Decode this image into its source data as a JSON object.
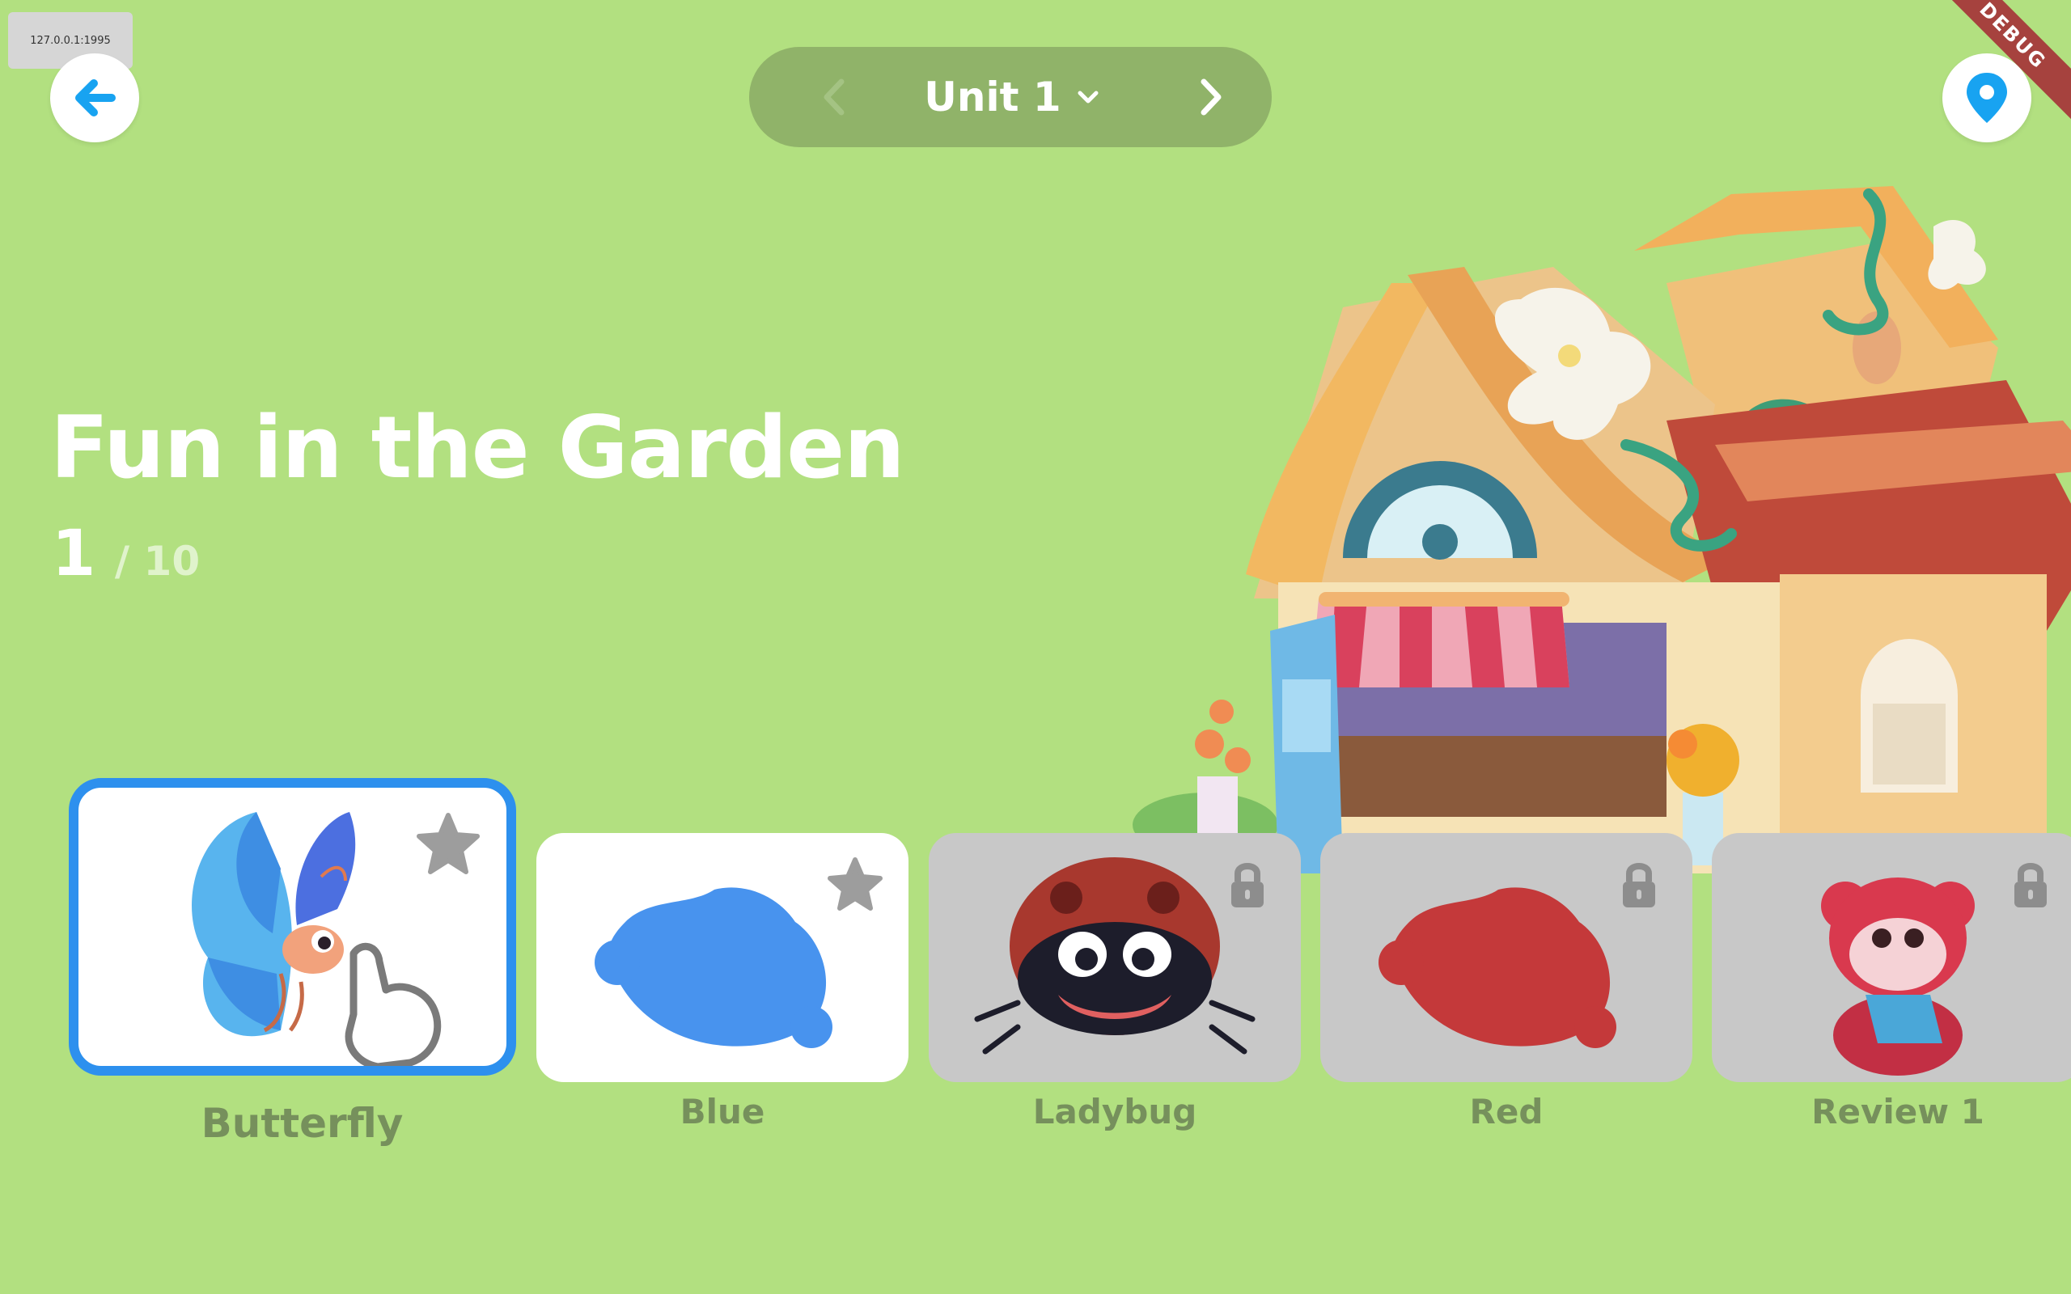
{
  "host_badge": "127.0.0.1:1995",
  "debug_banner": "DEBUG",
  "header": {
    "unit_label": "Unit 1"
  },
  "title": "Fun in the Garden",
  "progress": {
    "current": "1",
    "total": "/ 10"
  },
  "lessons": [
    {
      "label": "Butterfly",
      "state": "selected",
      "corner": "star-icon"
    },
    {
      "label": "Blue",
      "state": "available",
      "corner": "star-icon"
    },
    {
      "label": "Ladybug",
      "state": "locked",
      "corner": "lock-icon"
    },
    {
      "label": "Red",
      "state": "locked",
      "corner": "lock-icon"
    },
    {
      "label": "Review 1",
      "state": "locked",
      "corner": "lock-icon"
    }
  ],
  "colors": {
    "background": "#b2e080",
    "accent_blue": "#2d90ee",
    "label_green": "#76905c",
    "nav_pill": "#90b369",
    "locked_card": "#c8c8c8"
  }
}
